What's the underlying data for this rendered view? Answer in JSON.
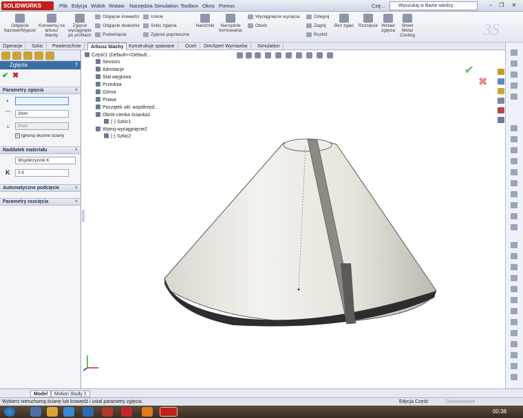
{
  "app": {
    "logo": "SOLIDWORKS",
    "menu": [
      "Plik",
      "Edycja",
      "Widok",
      "Wstaw",
      "Narzędzia",
      "Simulation",
      "Toolbox",
      "Okno",
      "Pomoc"
    ],
    "doc_title": "Czę...",
    "search_placeholder": "Wyszukaj w Bazie wiedzy"
  },
  "ribbon": {
    "big": [
      "Odgięcie bazowe/Wypust",
      "Konwertuj na arkusz blachy",
      "Zgięcie wyciągnięte po profilach"
    ],
    "col1": [
      "Odgięcie krawędzi",
      "Odgięcie dookolne",
      "Podwinięcie"
    ],
    "col2": [
      "Uskok",
      "Szkic zgięcia",
      "Zgięcie poprzeczne"
    ],
    "big2": [
      "Narożniki",
      "Narzędzie formowania"
    ],
    "col3": [
      "Wyciągnięcie wycięcia",
      "Otwór"
    ],
    "col4": [
      "Odegnij",
      "Zagnij",
      "Rozłóż"
    ],
    "big3": [
      "Bez zgięć",
      "Rozcięcie",
      "Wstaw zgięcia",
      "Sheet Metal Costing"
    ]
  },
  "tabs": [
    "Operacje",
    "Szkic",
    "Powierzchnie",
    "Arkusz blachy",
    "Konstrukcje spawane",
    "Oceń",
    "DimXpert Wymiarów",
    "Simulation"
  ],
  "active_tab": "Arkusz blachy",
  "panel": {
    "title": "Zgięcia",
    "help": "?",
    "sec1": "Parametry zgięcia",
    "radius": "3mm",
    "gap": "0mm",
    "ignore": "Ignoruj skośne ściany",
    "sec2": "Naddatek materiału",
    "ktype": "Współczynnik K",
    "k_label": "K",
    "k_value": "0.5",
    "sec3": "Automatyczne podcięcie",
    "sec4": "Parametry rozcięcia"
  },
  "tree": [
    "Część1  (Default<<Default...",
    "Sensors",
    "Adnotacje",
    "Stal węglowa",
    "Przednia",
    "Górna",
    "Prawa",
    "Początek ukł. współrzęd...",
    "Obrót-cienka ścianka1",
    "(-) Szkic1",
    "Wytnij-wyciągnięcie2",
    "(-) Szkic2"
  ],
  "bottom_tabs": [
    "Model",
    "Motion Study 1"
  ],
  "status": {
    "text": "Wybierz nieruchomą ścianę lub krawędź i ustal parametry zgięcia.",
    "mode": "Edycja Część",
    "units": "Dostosowane"
  },
  "clock": "00:38",
  "colors": {
    "accent": "#3a6ea5",
    "ok": "#2e9a2e",
    "cancel": "#c82020"
  }
}
